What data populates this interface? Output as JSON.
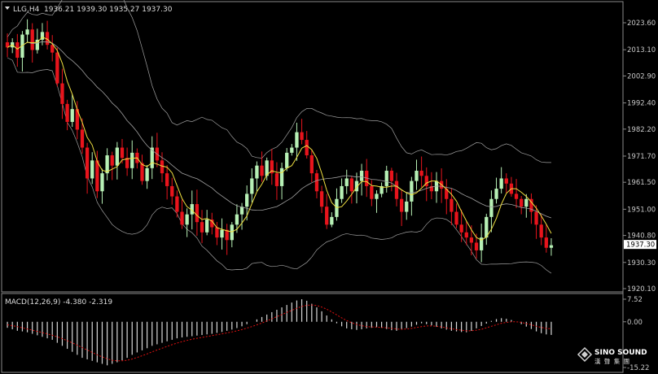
{
  "header": {
    "symbol": "LLG,H4",
    "ohlc": "1936.21 1939.30 1935.27 1937.30"
  },
  "indicator": {
    "label": "MACD(12,26,9) -4.380 -2.319"
  },
  "watermark": {
    "line1": "SINO SOUND",
    "line2": "漢 聲 集 團"
  },
  "colors": {
    "background": "#000000",
    "bull": "#b7f0b5",
    "bear": "#e8141c",
    "ma_fast": "#f0e040",
    "ma_slow": "#a0a0a0",
    "band": "#a0a0a0",
    "macd_hist": "#d8d8d8",
    "macd_signal": "#e01010",
    "price_tag": "#ffffff"
  },
  "chart_data": [
    {
      "type": "candlestick",
      "title": "LLG,H4",
      "current_price": "1937.30",
      "y_ticks": [
        "2023.60",
        "2013.10",
        "2002.90",
        "1992.40",
        "1982.20",
        "1971.70",
        "1961.50",
        "1951.00",
        "1940.80",
        "1930.30",
        "1920.10"
      ],
      "ylim": [
        1920.1,
        2023.6
      ],
      "grid": false,
      "series": [
        {
          "name": "price",
          "values": [
            2014,
            2016,
            2010,
            2019,
            2021,
            2013,
            2017,
            2020,
            2015,
            2012,
            2000,
            1992,
            1985,
            1990,
            1982,
            1975,
            1963,
            1970,
            1958,
            1965,
            1972,
            1968,
            1975,
            1971,
            1967,
            1973,
            1969,
            1962,
            1967,
            1975,
            1970,
            1965,
            1960,
            1956,
            1950,
            1945,
            1949,
            1953,
            1946,
            1942,
            1947,
            1944,
            1940,
            1943,
            1939,
            1945,
            1949,
            1952,
            1957,
            1963,
            1968,
            1964,
            1970,
            1965,
            1960,
            1967,
            1973,
            1975,
            1981,
            1978,
            1972,
            1965,
            1958,
            1952,
            1945,
            1948,
            1955,
            1960,
            1963,
            1958,
            1962,
            1966,
            1960,
            1955,
            1957,
            1960,
            1966,
            1962,
            1955,
            1950,
            1954,
            1962,
            1966,
            1964,
            1960,
            1958,
            1962,
            1959,
            1955,
            1950,
            1945,
            1942,
            1940,
            1938,
            1935,
            1940,
            1948,
            1955,
            1959,
            1963,
            1961,
            1957,
            1955,
            1952,
            1955,
            1950,
            1945,
            1940,
            1936,
            1937
          ]
        }
      ]
    },
    {
      "type": "bar",
      "title": "MACD(12,26,9) -4.380 -2.319",
      "y_ticks": [
        "7.52",
        "0.00",
        "-15.22"
      ],
      "ylim": [
        -15.22,
        7.52
      ],
      "grid": false,
      "series": [
        {
          "name": "MACD",
          "values": [
            -2,
            -2.5,
            -3,
            -3.2,
            -3.5,
            -4,
            -4.5,
            -5,
            -5.5,
            -6,
            -7,
            -8,
            -9,
            -10,
            -11,
            -12,
            -12.5,
            -13,
            -13.5,
            -14,
            -14.5,
            -14,
            -13.5,
            -12.8,
            -12,
            -11,
            -10.2,
            -9.5,
            -8.8,
            -8,
            -7.5,
            -7,
            -6.5,
            -6,
            -5.5,
            -5.2,
            -5,
            -4.8,
            -4.6,
            -4.4,
            -4.2,
            -4,
            -3.7,
            -3.4,
            -3,
            -2.6,
            -2.1,
            -1.5,
            -0.8,
            0,
            0.8,
            1.6,
            2.4,
            3.2,
            4,
            4.8,
            5.6,
            6.4,
            7.1,
            7.5,
            7,
            6,
            4.8,
            3.5,
            2.1,
            0.8,
            -0.5,
            -1.5,
            -2.2,
            -2.5,
            -2.7,
            -2.5,
            -2.2,
            -2,
            -1.8,
            -2,
            -2.4,
            -2.8,
            -3,
            -2.6,
            -2.1,
            -1.6,
            -1,
            -0.5,
            -0.8,
            -1.2,
            -1.7,
            -2.2,
            -2.6,
            -3,
            -3.2,
            -3.4,
            -3.5,
            -3,
            -2.2,
            -1.4,
            -0.6,
            0.3,
            0.9,
            1.2,
            1,
            0.6,
            0,
            -0.8,
            -1.6,
            -2.4,
            -3.2,
            -3.8,
            -4.2,
            -4.38
          ]
        },
        {
          "name": "Signal",
          "values": [
            -1,
            -1.3,
            -1.6,
            -2,
            -2.4,
            -2.8,
            -3.2,
            -3.6,
            -4,
            -4.5,
            -5,
            -5.6,
            -6.3,
            -7,
            -7.8,
            -8.6,
            -9.4,
            -10.2,
            -11,
            -11.7,
            -12.3,
            -12.8,
            -13,
            -13,
            -12.8,
            -12.4,
            -11.9,
            -11.3,
            -10.7,
            -10,
            -9.4,
            -8.8,
            -8.2,
            -7.6,
            -7.1,
            -6.6,
            -6.2,
            -5.8,
            -5.5,
            -5.2,
            -4.9,
            -4.6,
            -4.3,
            -4,
            -3.7,
            -3.4,
            -3,
            -2.6,
            -2.1,
            -1.6,
            -1,
            -0.4,
            0.3,
            1,
            1.7,
            2.4,
            3.1,
            3.8,
            4.5,
            5.1,
            5.5,
            5.6,
            5.4,
            4.9,
            4.2,
            3.3,
            2.3,
            1.3,
            0.4,
            -0.3,
            -0.9,
            -1.3,
            -1.6,
            -1.7,
            -1.8,
            -1.9,
            -2,
            -2.2,
            -2.4,
            -2.5,
            -2.4,
            -2.2,
            -1.9,
            -1.6,
            -1.4,
            -1.4,
            -1.5,
            -1.7,
            -2,
            -2.3,
            -2.6,
            -2.8,
            -3,
            -3,
            -2.8,
            -2.5,
            -2,
            -1.5,
            -1,
            -0.5,
            -0.2,
            0,
            0,
            -0.2,
            -0.6,
            -1,
            -1.5,
            -1.9,
            -2.2,
            -2.319
          ]
        }
      ]
    }
  ]
}
